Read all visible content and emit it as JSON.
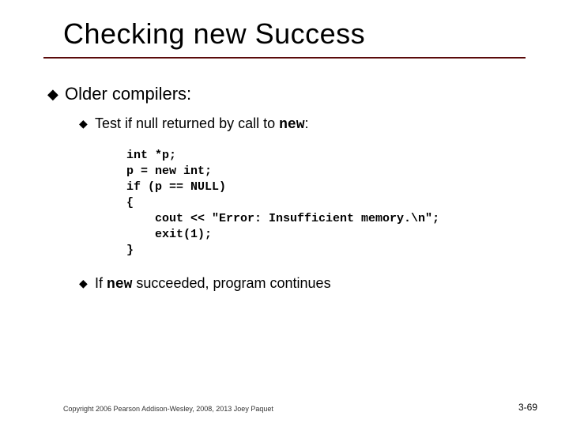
{
  "title": "Checking new Success",
  "bullets": {
    "b1": {
      "text": "Older compilers:",
      "sub": {
        "s1": {
          "prefix": "Test if null returned by call to ",
          "kw": "new",
          "suffix": ":"
        },
        "s2": {
          "prefix": "If ",
          "kw": "new",
          "suffix": " succeeded, program continues"
        }
      }
    }
  },
  "code": "int *p;\np = new int;\nif (p == NULL)\n{\n    cout << \"Error: Insufficient memory.\\n\";\n    exit(1);\n}",
  "footer": {
    "copyright": "Copyright 2006 Pearson Addison-Wesley, 2008, 2013 Joey Paquet",
    "page": "3-69"
  }
}
